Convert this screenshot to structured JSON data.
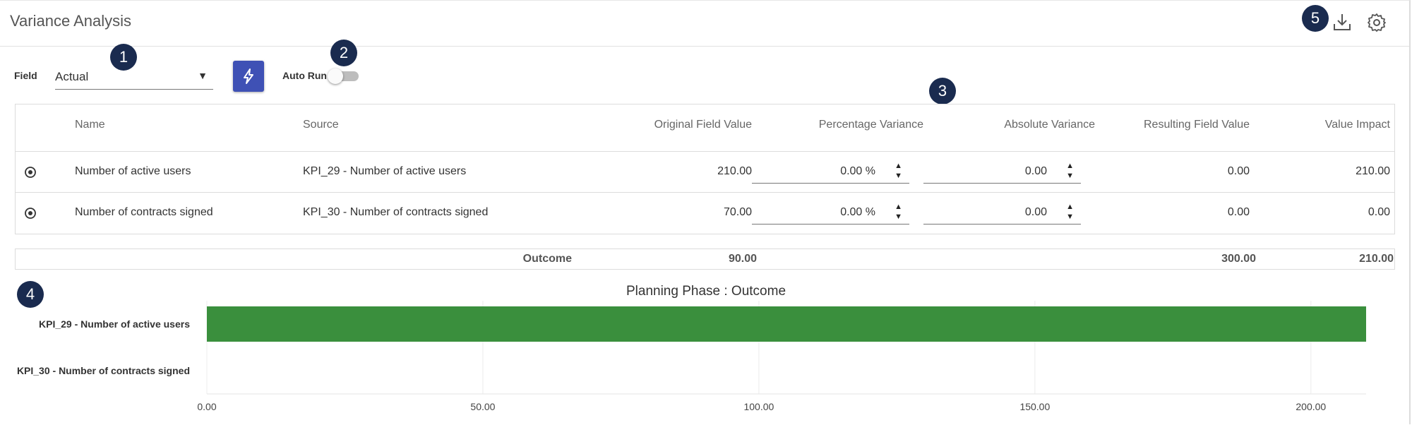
{
  "header": {
    "title": "Variance Analysis"
  },
  "badges": [
    "1",
    "2",
    "3",
    "4",
    "5"
  ],
  "toolbar": {
    "field_label": "Field",
    "field_value": "Actual",
    "autorun_label": "Auto Run",
    "autorun_on": false
  },
  "table": {
    "columns": [
      "Name",
      "Source",
      "Original Field Value",
      "Percentage Variance",
      "Absolute Variance",
      "Resulting Field Value",
      "Value Impact"
    ],
    "rows": [
      {
        "name": "Number of active users",
        "source": "KPI_29 - Number of active users",
        "original": "210.00",
        "pct": "0.00 %",
        "abs": "0.00",
        "resulting": "0.00",
        "impact": "210.00"
      },
      {
        "name": "Number of contracts signed",
        "source": "KPI_30 - Number of contracts signed",
        "original": "70.00",
        "pct": "0.00 %",
        "abs": "0.00",
        "resulting": "0.00",
        "impact": "0.00"
      }
    ]
  },
  "outcome": {
    "label": "Outcome",
    "original": "90.00",
    "resulting": "300.00",
    "impact": "210.00"
  },
  "chart_data": {
    "type": "bar",
    "orientation": "horizontal",
    "title": "Planning Phase : Outcome",
    "categories": [
      "KPI_29 - Number of active users",
      "KPI_30 - Number of contracts signed"
    ],
    "values": [
      210,
      0
    ],
    "xlim": [
      0,
      210
    ],
    "ticks": [
      0,
      50,
      100,
      150,
      200
    ],
    "tick_labels": [
      "0.00",
      "50.00",
      "100.00",
      "150.00",
      "200.00"
    ],
    "bar_color": "#3a8f3d",
    "grid": true
  },
  "colors": {
    "accent": "#3f51b5",
    "badge": "#1a2b4f"
  }
}
